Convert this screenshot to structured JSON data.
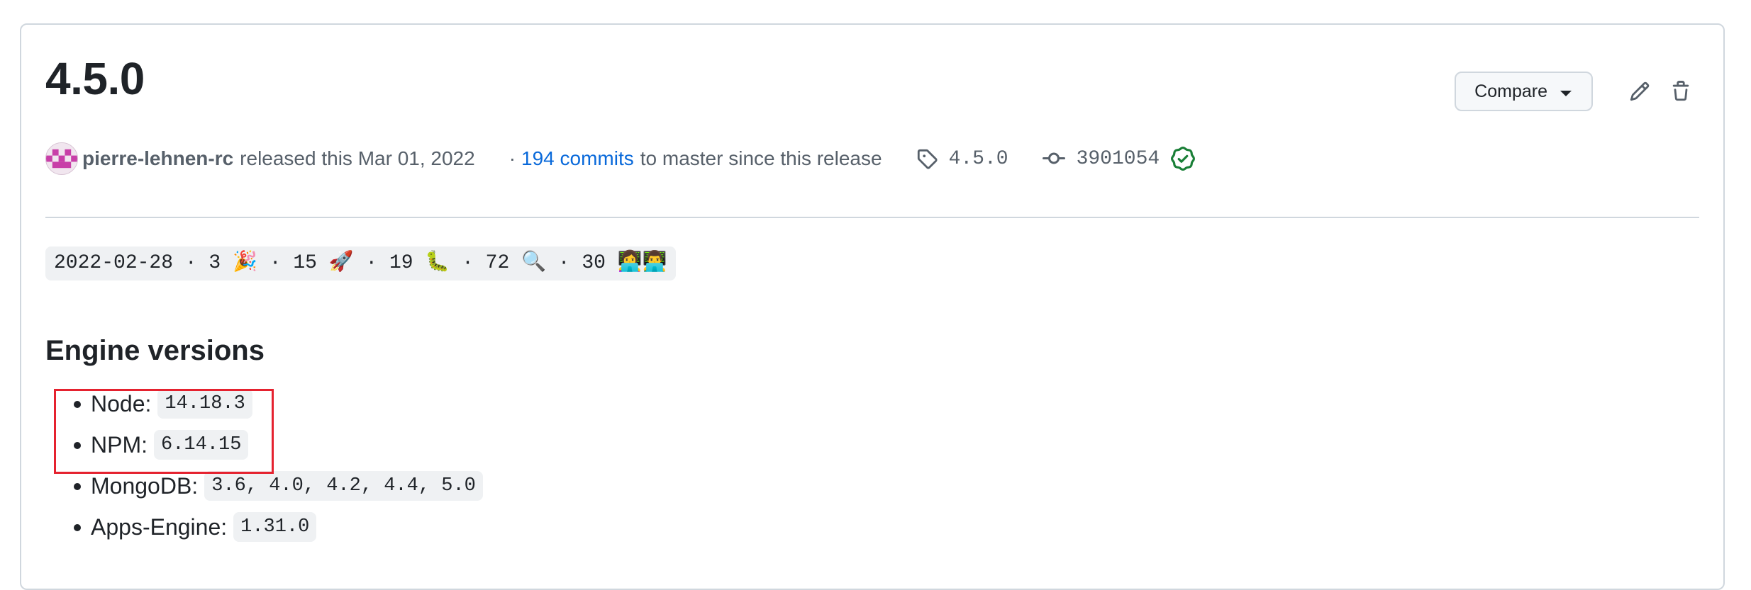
{
  "release": {
    "title": "4.5.0",
    "compare_label": "Compare",
    "author": "pierre-lehnen-rc",
    "released_text": "released this Mar 01, 2022",
    "separator": "·",
    "commits_link": "194 commits",
    "commits_suffix": "to master since this release",
    "tag": "4.5.0",
    "commit_sha": "3901054"
  },
  "body": {
    "stats_line": "2022-02-28 · 3 🎉 · 15 🚀 · 19 🐛 · 72 🔍 · 30 👩‍💻👨‍💻",
    "section_heading": "Engine versions",
    "engines": [
      {
        "label": "Node:",
        "value": "14.18.3"
      },
      {
        "label": "NPM:",
        "value": "6.14.15"
      },
      {
        "label": "MongoDB:",
        "value": "3.6, 4.0, 4.2, 4.4, 5.0"
      },
      {
        "label": "Apps-Engine:",
        "value": "1.31.0"
      }
    ]
  },
  "icons": {
    "edit": "pencil-icon",
    "delete": "trash-icon",
    "tag": "tag-icon",
    "commit": "git-commit-icon",
    "verified": "verified-check-icon"
  },
  "colors": {
    "link": "#0969da",
    "verified": "#1a7f37",
    "highlight": "#e5222f"
  }
}
